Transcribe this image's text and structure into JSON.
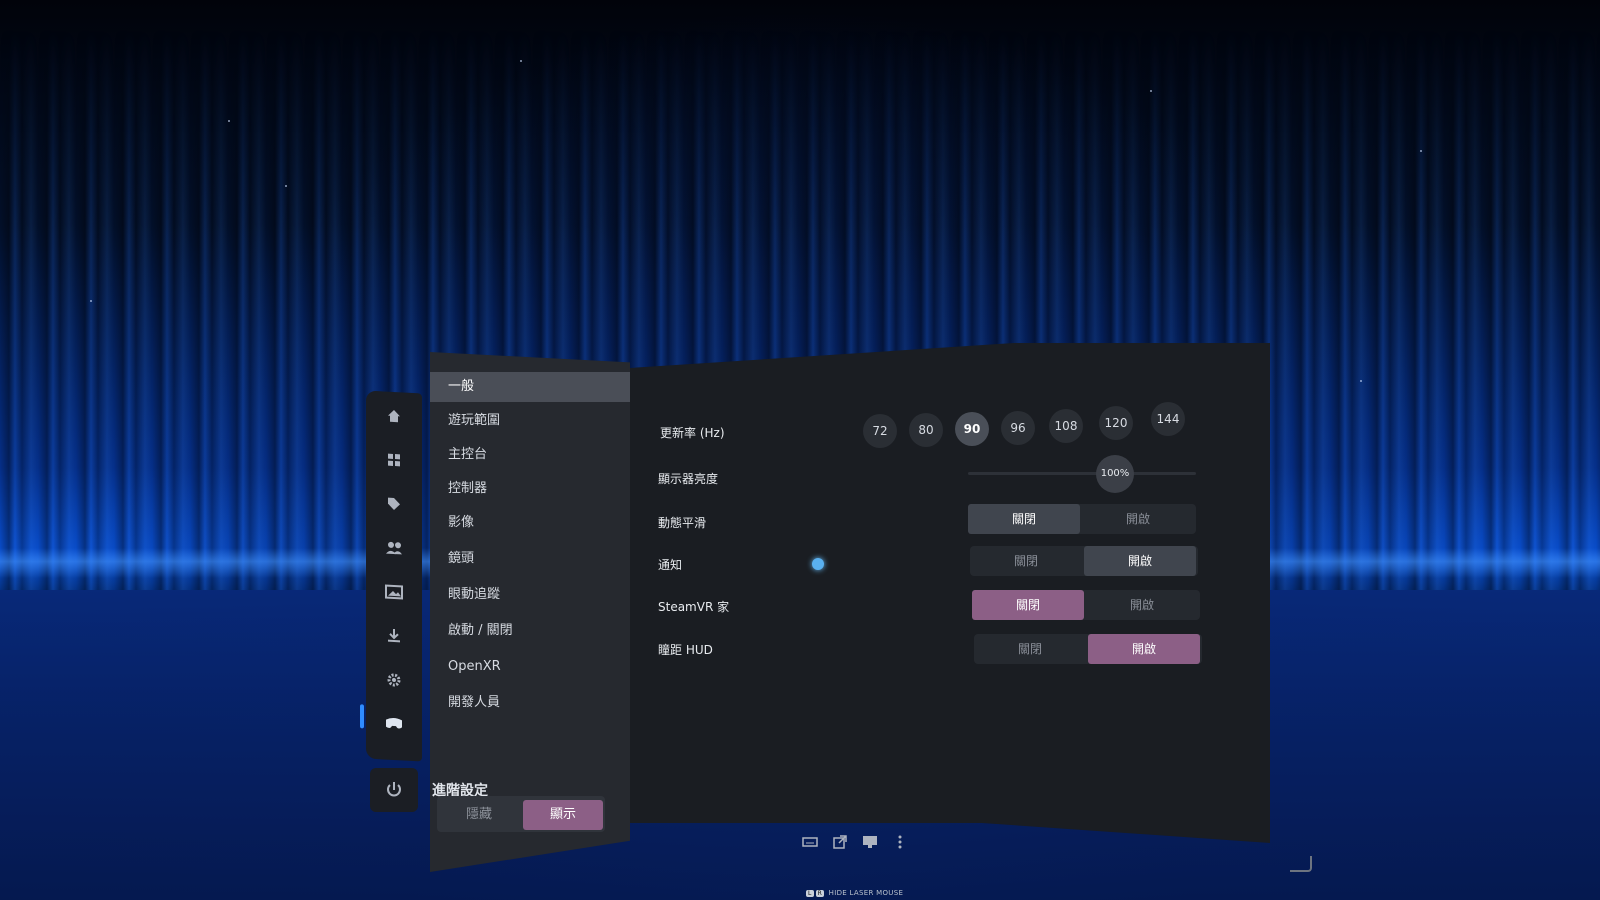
{
  "sidebar": {
    "items": [
      {
        "label": "一般",
        "selected": true
      },
      {
        "label": "遊玩範圍"
      },
      {
        "label": "主控台"
      },
      {
        "label": "控制器"
      },
      {
        "label": "影像"
      },
      {
        "label": "鏡頭"
      },
      {
        "label": "眼動追蹤"
      },
      {
        "label": "啟動 / 關閉"
      },
      {
        "label": "OpenXR"
      },
      {
        "label": "開發人員"
      }
    ],
    "advanced": {
      "title": "進階設定",
      "hide_label": "隱藏",
      "show_label": "顯示",
      "selected": "顯示"
    }
  },
  "rail": {
    "icons": [
      "home-icon",
      "library-icon",
      "store-tag-icon",
      "friends-icon",
      "media-icon",
      "download-icon",
      "settings-gear-icon",
      "headset-icon"
    ],
    "active": "headset-icon",
    "power": "power-icon"
  },
  "settings": {
    "refresh_rate": {
      "label": "更新率 (Hz)",
      "options": [
        "72",
        "80",
        "90",
        "96",
        "108",
        "120",
        "144"
      ],
      "selected": "90"
    },
    "brightness": {
      "label": "顯示器亮度",
      "value": "100%"
    },
    "motion_smoothing": {
      "label": "動態平滑",
      "off": "關閉",
      "on": "開啟",
      "selected": "關閉"
    },
    "notifications": {
      "label": "通知",
      "off": "關閉",
      "on": "開啟",
      "selected": "開啟"
    },
    "steamvr_home": {
      "label": "SteamVR 家",
      "off": "關閉",
      "on": "開啟",
      "selected": "關閉"
    },
    "ipd_hud": {
      "label": "瞳距 HUD",
      "off": "關閉",
      "on": "開啟",
      "selected": "開啟"
    }
  },
  "bottom_bar": {
    "icons": [
      "keyboard-icon",
      "popout-icon",
      "desktop-icon",
      "more-icon"
    ],
    "hint_keys": [
      "L",
      "R"
    ],
    "hint": "HIDE LASER MOUSE"
  }
}
